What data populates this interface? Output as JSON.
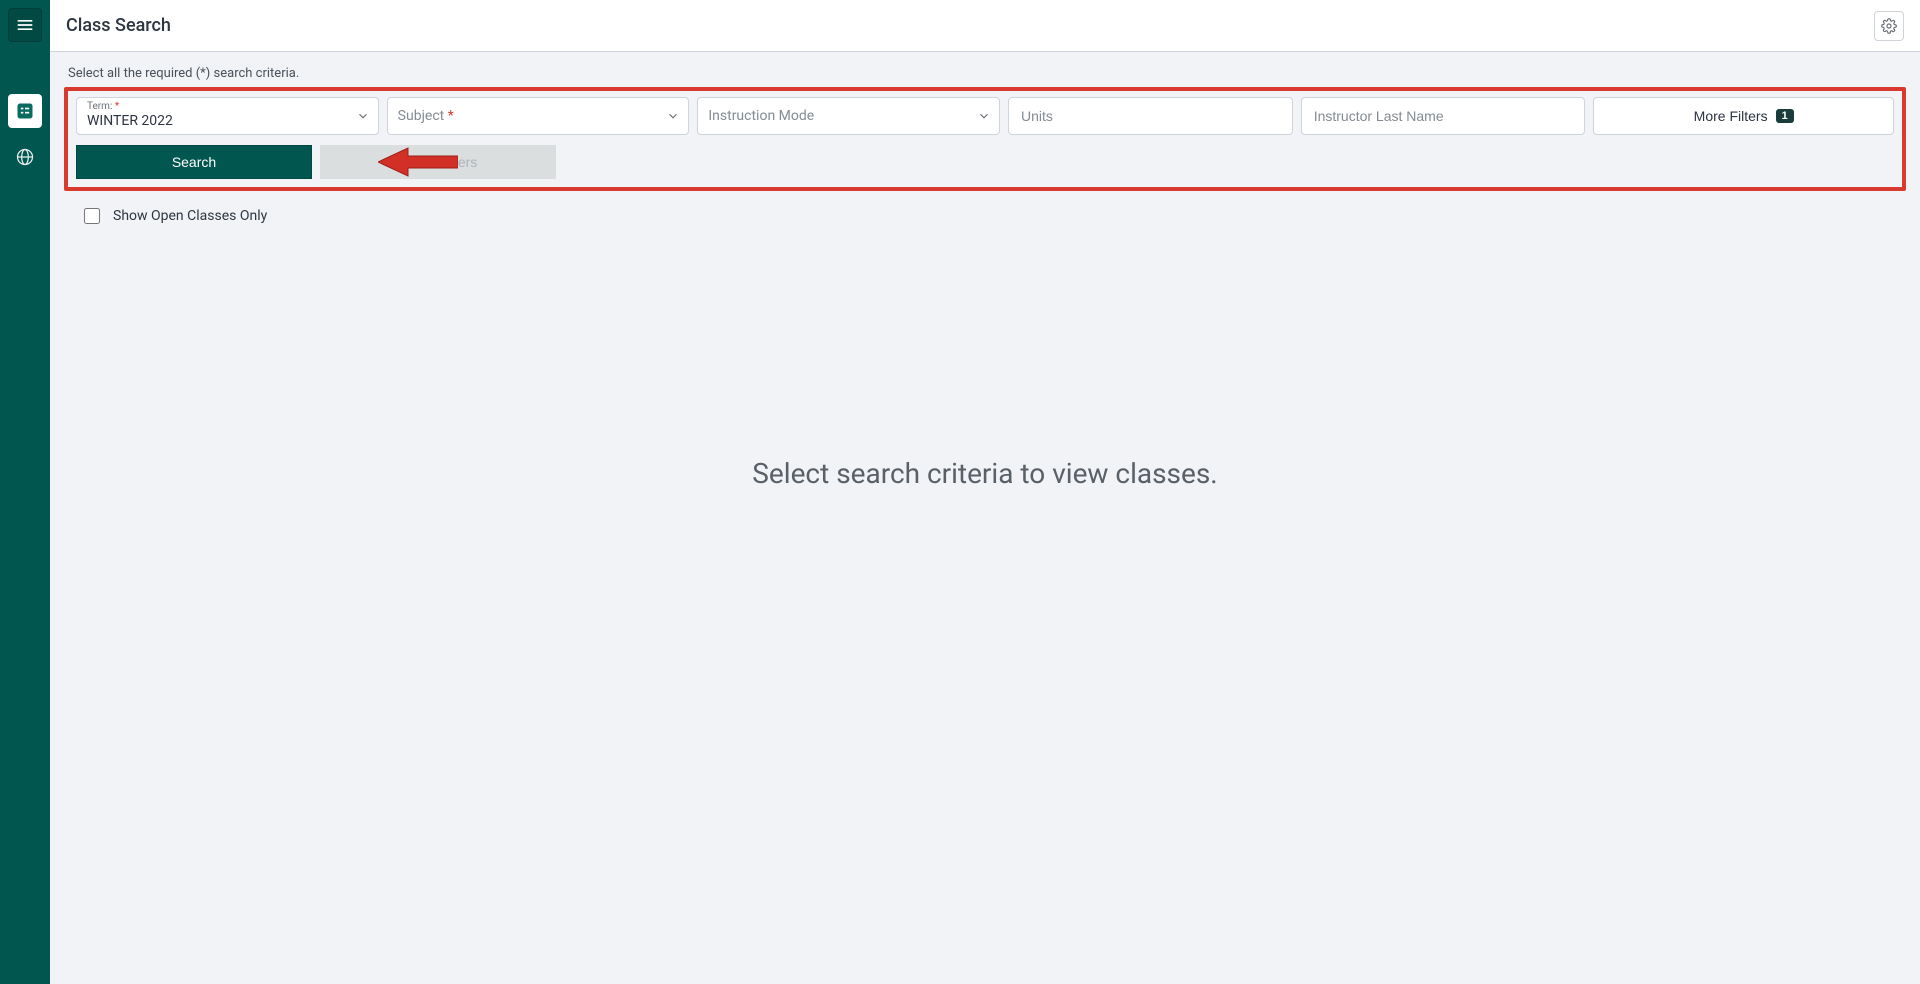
{
  "header": {
    "title": "Class Search"
  },
  "instruction": "Select all the required (*) search criteria.",
  "filters": {
    "term": {
      "label": "Term:",
      "required": true,
      "value": "WINTER 2022"
    },
    "subject": {
      "placeholder": "Subject",
      "required": true
    },
    "instruction_mode": {
      "placeholder": "Instruction Mode"
    },
    "units": {
      "placeholder": "Units"
    },
    "instructor_last_name": {
      "placeholder": "Instructor Last Name"
    },
    "more_filters": {
      "label": "More Filters",
      "count": "1"
    }
  },
  "actions": {
    "search_label": "Search",
    "reset_label": "Reset Filters"
  },
  "open_classes": {
    "label": "Show Open Classes Only",
    "checked": false
  },
  "empty_state": "Select search criteria to view classes."
}
